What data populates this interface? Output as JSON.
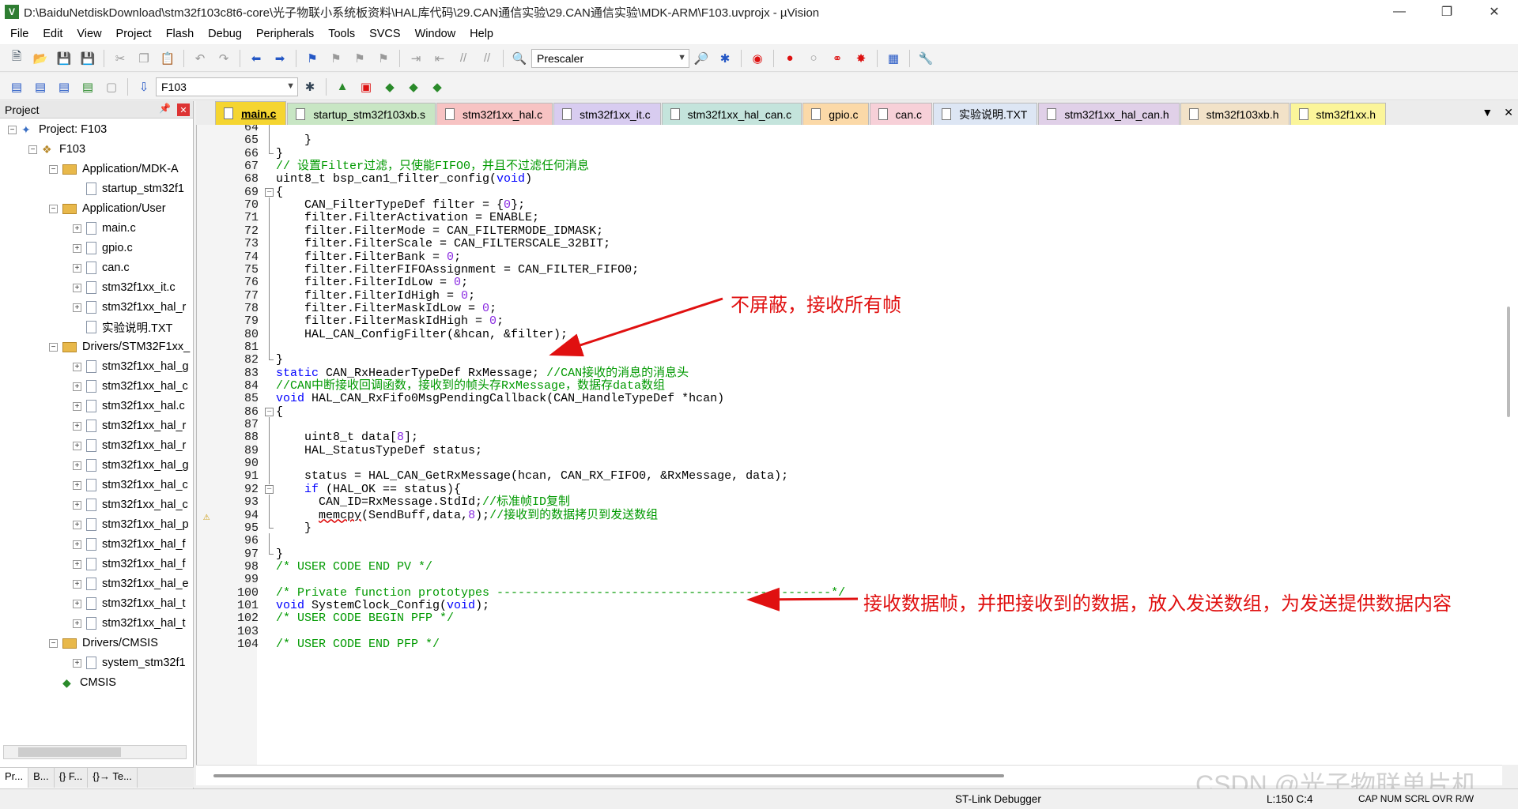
{
  "window": {
    "title": "D:\\BaiduNetdiskDownload\\stm32f103c8t6-core\\光子物联小系统板资料\\HAL库代码\\29.CAN通信实验\\29.CAN通信实验\\MDK-ARM\\F103.uvprojx - µVision"
  },
  "menu": [
    "File",
    "Edit",
    "View",
    "Project",
    "Flash",
    "Debug",
    "Peripherals",
    "Tools",
    "SVCS",
    "Window",
    "Help"
  ],
  "toolbar": {
    "find_combo": "Prescaler",
    "target_combo": "F103"
  },
  "project": {
    "header": "Project",
    "tree": [
      {
        "label": "Project: F103",
        "level": 0,
        "kind": "project",
        "exp": "−"
      },
      {
        "label": "F103",
        "level": 1,
        "kind": "target",
        "exp": "−"
      },
      {
        "label": "Application/MDK-A",
        "level": 2,
        "kind": "folder",
        "exp": "−"
      },
      {
        "label": "startup_stm32f1",
        "level": 3,
        "kind": "file",
        "exp": ""
      },
      {
        "label": "Application/User",
        "level": 2,
        "kind": "folder",
        "exp": "−"
      },
      {
        "label": "main.c",
        "level": 3,
        "kind": "file",
        "exp": "+"
      },
      {
        "label": "gpio.c",
        "level": 3,
        "kind": "file",
        "exp": "+"
      },
      {
        "label": "can.c",
        "level": 3,
        "kind": "file",
        "exp": "+"
      },
      {
        "label": "stm32f1xx_it.c",
        "level": 3,
        "kind": "file",
        "exp": "+"
      },
      {
        "label": "stm32f1xx_hal_r",
        "level": 3,
        "kind": "file",
        "exp": "+"
      },
      {
        "label": "实验说明.TXT",
        "level": 3,
        "kind": "file",
        "exp": ""
      },
      {
        "label": "Drivers/STM32F1xx_",
        "level": 2,
        "kind": "folder",
        "exp": "−"
      },
      {
        "label": "stm32f1xx_hal_g",
        "level": 3,
        "kind": "file",
        "exp": "+"
      },
      {
        "label": "stm32f1xx_hal_c",
        "level": 3,
        "kind": "file",
        "exp": "+"
      },
      {
        "label": "stm32f1xx_hal.c",
        "level": 3,
        "kind": "file",
        "exp": "+"
      },
      {
        "label": "stm32f1xx_hal_r",
        "level": 3,
        "kind": "file",
        "exp": "+"
      },
      {
        "label": "stm32f1xx_hal_r",
        "level": 3,
        "kind": "file",
        "exp": "+"
      },
      {
        "label": "stm32f1xx_hal_g",
        "level": 3,
        "kind": "file",
        "exp": "+"
      },
      {
        "label": "stm32f1xx_hal_c",
        "level": 3,
        "kind": "file",
        "exp": "+"
      },
      {
        "label": "stm32f1xx_hal_c",
        "level": 3,
        "kind": "file",
        "exp": "+"
      },
      {
        "label": "stm32f1xx_hal_p",
        "level": 3,
        "kind": "file",
        "exp": "+"
      },
      {
        "label": "stm32f1xx_hal_f",
        "level": 3,
        "kind": "file",
        "exp": "+"
      },
      {
        "label": "stm32f1xx_hal_f",
        "level": 3,
        "kind": "file",
        "exp": "+"
      },
      {
        "label": "stm32f1xx_hal_e",
        "level": 3,
        "kind": "file",
        "exp": "+"
      },
      {
        "label": "stm32f1xx_hal_t",
        "level": 3,
        "kind": "file",
        "exp": "+"
      },
      {
        "label": "stm32f1xx_hal_t",
        "level": 3,
        "kind": "file",
        "exp": "+"
      },
      {
        "label": "Drivers/CMSIS",
        "level": 2,
        "kind": "folder",
        "exp": "−"
      },
      {
        "label": "system_stm32f1",
        "level": 3,
        "kind": "file",
        "exp": "+"
      },
      {
        "label": "CMSIS",
        "level": 2,
        "kind": "cube",
        "exp": ""
      }
    ],
    "bottom_tabs": [
      "Pr...",
      "B...",
      "{} F...",
      "{}→ Te..."
    ]
  },
  "tabs": [
    {
      "label": "main.c",
      "color": "#f5d530",
      "active": true
    },
    {
      "label": "startup_stm32f103xb.s",
      "color": "#c8e6c4"
    },
    {
      "label": "stm32f1xx_hal.c",
      "color": "#f7c3c3"
    },
    {
      "label": "stm32f1xx_it.c",
      "color": "#d8ccf0"
    },
    {
      "label": "stm32f1xx_hal_can.c",
      "color": "#c4e4dc"
    },
    {
      "label": "gpio.c",
      "color": "#fbd9a8"
    },
    {
      "label": "can.c",
      "color": "#f7d0d8"
    },
    {
      "label": "实验说明.TXT",
      "color": "#dde6f4"
    },
    {
      "label": "stm32f1xx_hal_can.h",
      "color": "#e0d0e8"
    },
    {
      "label": "stm32f103xb.h",
      "color": "#f2e2c8"
    },
    {
      "label": "stm32f1xx.h",
      "color": "#fbf59a"
    }
  ],
  "code": [
    {
      "n": "64",
      "fold": "vline",
      "parts": []
    },
    {
      "n": "65",
      "fold": "vline",
      "parts": [
        [
          "t",
          "    }"
        ]
      ]
    },
    {
      "n": "66",
      "fold": "end",
      "parts": [
        [
          "t",
          "}"
        ]
      ]
    },
    {
      "n": "67",
      "fold": "",
      "parts": [
        [
          "cm",
          "// 设置Filter过滤，只使能FIFO0，并且不过滤任何消息"
        ]
      ]
    },
    {
      "n": "68",
      "fold": "",
      "parts": [
        [
          "t",
          "uint8_t bsp_can1_filter_config("
        ],
        [
          "kw",
          "void"
        ],
        [
          "t",
          ")"
        ]
      ]
    },
    {
      "n": "69",
      "fold": "box",
      "parts": [
        [
          "t",
          "{"
        ]
      ]
    },
    {
      "n": "70",
      "fold": "vline",
      "parts": [
        [
          "t",
          "    CAN_FilterTypeDef filter = {"
        ],
        [
          "nm",
          "0"
        ],
        [
          "t",
          "};"
        ]
      ]
    },
    {
      "n": "71",
      "fold": "vline",
      "parts": [
        [
          "t",
          "    filter.FilterActivation = ENABLE;"
        ]
      ]
    },
    {
      "n": "72",
      "fold": "vline",
      "parts": [
        [
          "t",
          "    filter.FilterMode = CAN_FILTERMODE_IDMASK;"
        ]
      ]
    },
    {
      "n": "73",
      "fold": "vline",
      "parts": [
        [
          "t",
          "    filter.FilterScale = CAN_FILTERSCALE_32BIT;"
        ]
      ]
    },
    {
      "n": "74",
      "fold": "vline",
      "parts": [
        [
          "t",
          "    filter.FilterBank = "
        ],
        [
          "nm",
          "0"
        ],
        [
          "t",
          ";"
        ]
      ]
    },
    {
      "n": "75",
      "fold": "vline",
      "parts": [
        [
          "t",
          "    filter.FilterFIFOAssignment = CAN_FILTER_FIFO0;"
        ]
      ]
    },
    {
      "n": "76",
      "fold": "vline",
      "parts": [
        [
          "t",
          "    filter.FilterIdLow = "
        ],
        [
          "nm",
          "0"
        ],
        [
          "t",
          ";"
        ]
      ]
    },
    {
      "n": "77",
      "fold": "vline",
      "parts": [
        [
          "t",
          "    filter.FilterIdHigh = "
        ],
        [
          "nm",
          "0"
        ],
        [
          "t",
          ";"
        ]
      ]
    },
    {
      "n": "78",
      "fold": "vline",
      "parts": [
        [
          "t",
          "    filter.FilterMaskIdLow = "
        ],
        [
          "nm",
          "0"
        ],
        [
          "t",
          ";"
        ]
      ]
    },
    {
      "n": "79",
      "fold": "vline",
      "parts": [
        [
          "t",
          "    filter.FilterMaskIdHigh = "
        ],
        [
          "nm",
          "0"
        ],
        [
          "t",
          ";"
        ]
      ]
    },
    {
      "n": "80",
      "fold": "vline",
      "parts": [
        [
          "t",
          "    HAL_CAN_ConfigFilter(&hcan, &filter);"
        ]
      ]
    },
    {
      "n": "81",
      "fold": "vline",
      "parts": []
    },
    {
      "n": "82",
      "fold": "end",
      "parts": [
        [
          "t",
          "}"
        ]
      ]
    },
    {
      "n": "83",
      "fold": "",
      "parts": [
        [
          "kw",
          "static"
        ],
        [
          "t",
          " CAN_RxHeaderTypeDef RxMessage; "
        ],
        [
          "cm",
          "//CAN接收的消息的消息头"
        ]
      ]
    },
    {
      "n": "84",
      "fold": "",
      "parts": [
        [
          "cm",
          "//CAN中断接收回调函数，接收到的帧头存RxMessage，数据存data数组"
        ]
      ]
    },
    {
      "n": "85",
      "fold": "",
      "parts": [
        [
          "kw",
          "void"
        ],
        [
          "t",
          " HAL_CAN_RxFifo0MsgPendingCallback(CAN_HandleTypeDef *hcan)"
        ]
      ]
    },
    {
      "n": "86",
      "fold": "box",
      "parts": [
        [
          "t",
          "{"
        ]
      ]
    },
    {
      "n": "87",
      "fold": "vline",
      "parts": []
    },
    {
      "n": "88",
      "fold": "vline",
      "parts": [
        [
          "t",
          "    uint8_t data["
        ],
        [
          "nm",
          "8"
        ],
        [
          "t",
          "];"
        ]
      ]
    },
    {
      "n": "89",
      "fold": "vline",
      "parts": [
        [
          "t",
          "    HAL_StatusTypeDef status;"
        ]
      ]
    },
    {
      "n": "90",
      "fold": "vline",
      "parts": []
    },
    {
      "n": "91",
      "fold": "vline",
      "parts": [
        [
          "t",
          "    status = HAL_CAN_GetRxMessage(hcan, CAN_RX_FIFO0, &RxMessage, data);"
        ]
      ]
    },
    {
      "n": "92",
      "fold": "box",
      "parts": [
        [
          "t",
          "    "
        ],
        [
          "kw",
          "if"
        ],
        [
          "t",
          " (HAL_OK == status){"
        ]
      ]
    },
    {
      "n": "93",
      "fold": "vline",
      "parts": [
        [
          "t",
          "      CAN_ID=RxMessage.StdId;"
        ],
        [
          "cm",
          "//标准帧ID复制"
        ]
      ]
    },
    {
      "n": "94",
      "fold": "vline",
      "warn": true,
      "parts": [
        [
          "t",
          "      "
        ],
        [
          "sq",
          "memcpy"
        ],
        [
          "t",
          "(SendBuff,data,"
        ],
        [
          "nm",
          "8"
        ],
        [
          "t",
          ");"
        ],
        [
          "cm",
          "//接收到的数据拷贝到发送数组"
        ]
      ]
    },
    {
      "n": "95",
      "fold": "end",
      "parts": [
        [
          "t",
          "    }"
        ]
      ]
    },
    {
      "n": "96",
      "fold": "vline",
      "parts": []
    },
    {
      "n": "97",
      "fold": "end",
      "parts": [
        [
          "t",
          "}"
        ]
      ]
    },
    {
      "n": "98",
      "fold": "",
      "parts": [
        [
          "cm",
          "/* USER CODE END PV */"
        ]
      ]
    },
    {
      "n": "99",
      "fold": "",
      "parts": []
    },
    {
      "n": "100",
      "fold": "",
      "parts": [
        [
          "cm",
          "/* Private function prototypes -----------------------------------------------*/"
        ]
      ]
    },
    {
      "n": "101",
      "fold": "",
      "parts": [
        [
          "kw",
          "void"
        ],
        [
          "t",
          " SystemClock_Config("
        ],
        [
          "kw",
          "void"
        ],
        [
          "t",
          ");"
        ]
      ]
    },
    {
      "n": "102",
      "fold": "",
      "parts": [
        [
          "cm",
          "/* USER CODE BEGIN PFP */"
        ]
      ]
    },
    {
      "n": "103",
      "fold": "",
      "parts": []
    },
    {
      "n": "104",
      "fold": "",
      "parts": [
        [
          "cm",
          "/* USER CODE END PFP */"
        ]
      ]
    }
  ],
  "annotations": {
    "a1": "不屏蔽，接收所有帧",
    "a2": "接收数据帧，并把接收到的数据，放入发送数组，为发送提供数据内容"
  },
  "status": {
    "debugger": "ST-Link Debugger",
    "position": "L:150 C:4",
    "flags": "CAP  NUM  SCRL  OVR  R/W"
  },
  "watermark": "CSDN @光子物联单片机"
}
